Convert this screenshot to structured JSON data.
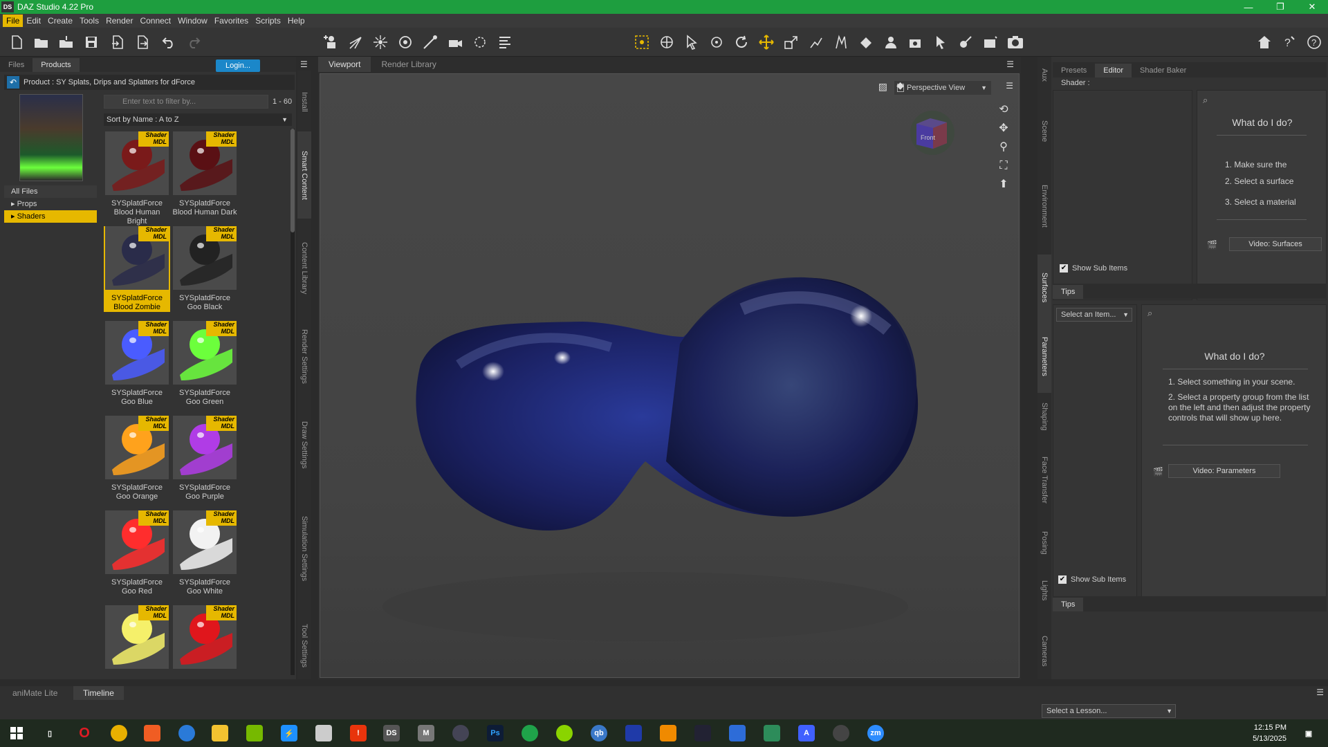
{
  "app": {
    "title": "DAZ Studio 4.22 Pro",
    "logo": "DS"
  },
  "window_buttons": [
    "—",
    "❐",
    "✕"
  ],
  "menu": [
    "File",
    "Edit",
    "Create",
    "Tools",
    "Render",
    "Connect",
    "Window",
    "Favorites",
    "Scripts",
    "Help"
  ],
  "left_panel": {
    "tabs": [
      "Files",
      "Products"
    ],
    "login_label": "Login...",
    "product_label": "Product : SY Splats, Drips and Splatters for dForce",
    "categories": [
      "All Files",
      "▸ Props",
      "▸ Shaders"
    ],
    "filter_placeholder": "Enter text to filter by...",
    "count": "1 - 60",
    "sort_label": "Sort by Name : A to Z",
    "tag_shader": "Shader",
    "tag_mdl": "MDL",
    "items": [
      {
        "name": "SYSplatdForce Blood Human Bright",
        "color": "#7a1a1a"
      },
      {
        "name": "SYSplatdForce Blood Human Dark",
        "color": "#5a1014"
      },
      {
        "name": "SYSplatdForce Blood Zombie",
        "color": "#2a2c4a"
      },
      {
        "name": "SYSplatdForce Goo Black",
        "color": "#222222"
      },
      {
        "name": "SYSplatdForce Goo Blue",
        "color": "#4a5cff"
      },
      {
        "name": "SYSplatdForce Goo Green",
        "color": "#6cff3c"
      },
      {
        "name": "SYSplatdForce Goo Orange",
        "color": "#ffa21c"
      },
      {
        "name": "SYSplatdForce Goo Purple",
        "color": "#b03ce6"
      },
      {
        "name": "SYSplatdForce Goo Red",
        "color": "#ff2d2d"
      },
      {
        "name": "SYSplatdForce Goo White",
        "color": "#f2f2f2"
      },
      {
        "name": "",
        "color": "#f5f06a"
      },
      {
        "name": "",
        "color": "#e0161c"
      }
    ],
    "side_tabs": [
      "Install",
      "Smart Content",
      "Content Library",
      "Render Settings",
      "Draw Settings",
      "Simulation Settings",
      "Tool Settings"
    ]
  },
  "viewport": {
    "tabs": [
      "Viewport",
      "Render Library"
    ],
    "view_label": "Perspective View",
    "cube_label": "Front"
  },
  "right_panel": {
    "tabs": [
      "Presets",
      "Editor",
      "Shader Baker"
    ],
    "shader_label": "Shader :",
    "surfaces_help": {
      "title": "What do I do?",
      "steps": [
        "1. Make sure the",
        "2. Select a surface",
        "3. Select a material"
      ],
      "video_label": "Video: Surfaces"
    },
    "show_sub_items": "Show Sub Items",
    "tips_label": "Tips",
    "select_item": "Select an Item...",
    "params_help": {
      "title": "What do I do?",
      "steps": [
        "1. Select something in your scene.",
        "2. Select a property group from the list on the left and then adjust the property controls that will show up here."
      ],
      "video_label": "Video: Parameters"
    },
    "side_tabs_top": [
      "Aux",
      "Scene",
      "Environment",
      "Surfaces"
    ],
    "side_tabs_bottom": [
      "Parameters",
      "Shaping",
      "Face Transfer",
      "Posing",
      "Lights",
      "Cameras"
    ]
  },
  "bottom": {
    "tabs": [
      "aniMate Lite",
      "Timeline"
    ],
    "lesson_label": "Select a Lesson..."
  },
  "taskbar": {
    "time": "12:15 PM",
    "date": "5/13/2025"
  }
}
